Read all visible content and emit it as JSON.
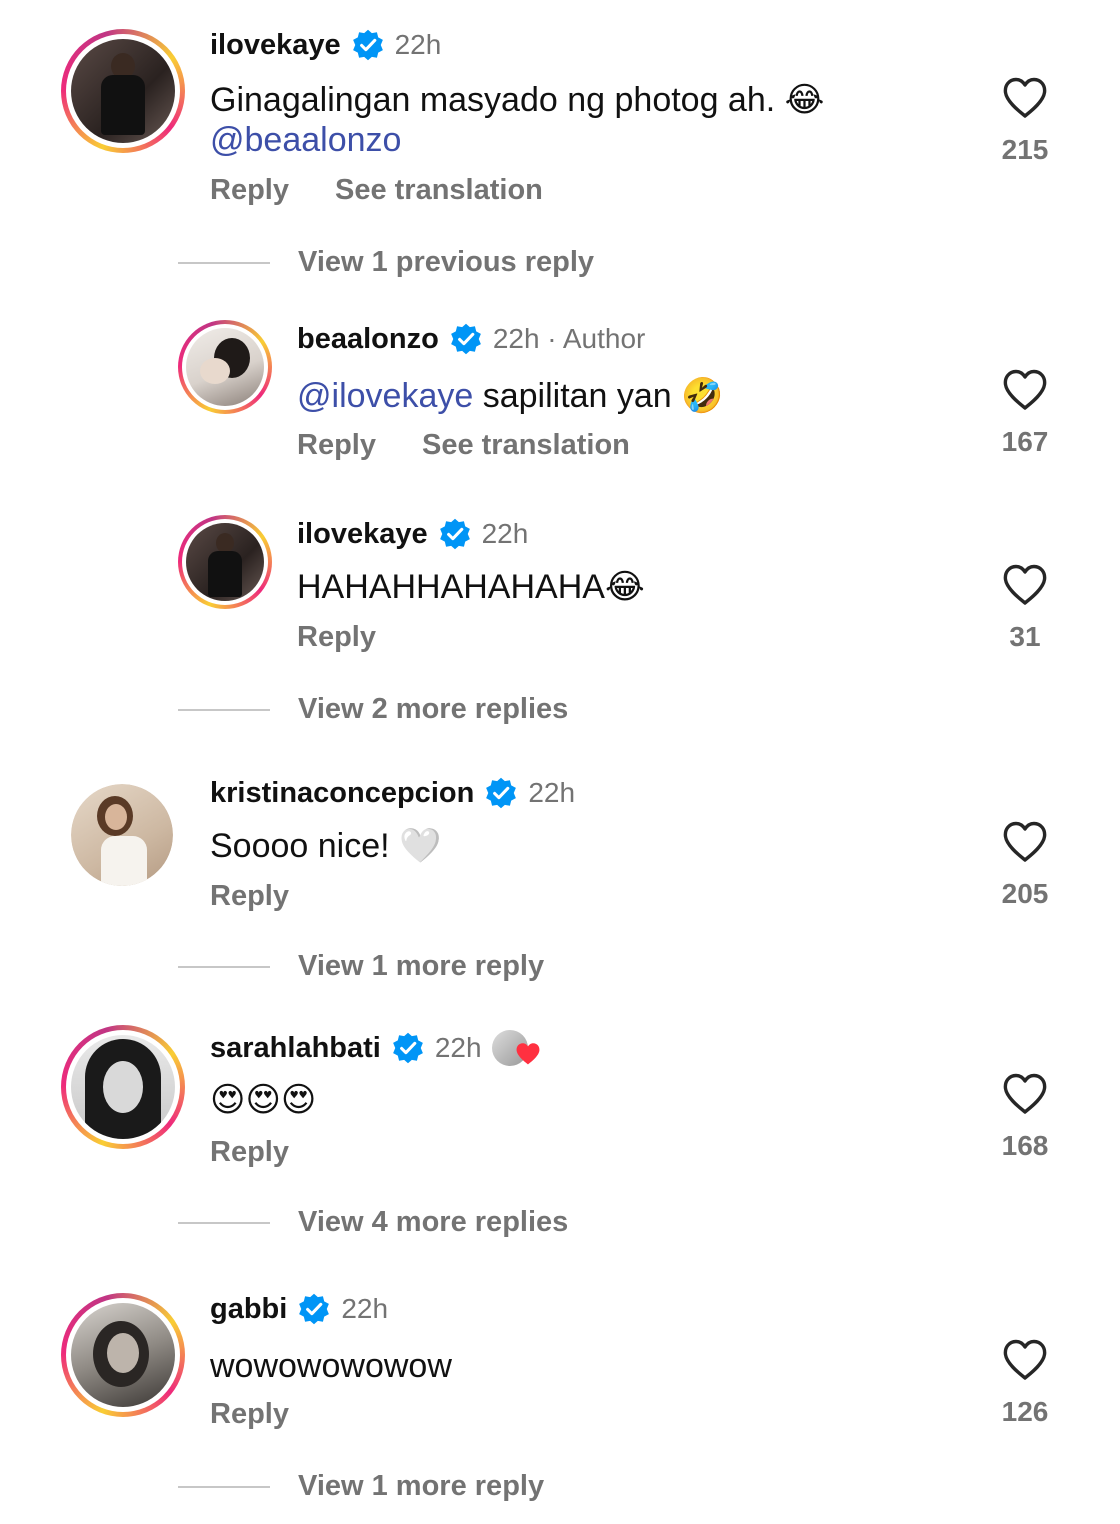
{
  "comments": [
    {
      "user": "ilovekaye",
      "time": "22h",
      "text": "Ginagalingan masyado ng photog ah. 😂",
      "mention": "@beaalonzo",
      "reply": "Reply",
      "translate": "See translation",
      "likes": "215",
      "view_more": "View 1 previous reply"
    },
    {
      "user": "beaalonzo",
      "time": "22h · Author",
      "mention": "@ilovekaye",
      "text": " sapilitan yan 🤣",
      "reply": "Reply",
      "translate": "See translation",
      "likes": "167"
    },
    {
      "user": "ilovekaye",
      "time": "22h",
      "text": "HAHAHHAHAHAHA😂",
      "reply": "Reply",
      "likes": "31",
      "view_more": "View 2 more replies"
    },
    {
      "user": "kristinaconcepcion",
      "time": "22h",
      "text": "Soooo nice! 🤍",
      "reply": "Reply",
      "likes": "205",
      "view_more": "View 1 more reply"
    },
    {
      "user": "sarahlahbati",
      "time": "22h",
      "text": "😍😍😍",
      "reply": "Reply",
      "likes": "168",
      "view_more": "View 4 more replies"
    },
    {
      "user": "gabbi",
      "time": "22h",
      "text": "wowowowowow",
      "reply": "Reply",
      "likes": "126",
      "view_more": "View 1 more reply"
    }
  ],
  "colors": {
    "verified": "#0095f6",
    "secondary_text": "#737373",
    "mention": "#3d4fa8",
    "story_ring": "#ee2a7b"
  },
  "icons": [
    "verified-badge-icon",
    "heart-outline-icon",
    "liked-by-author-icon"
  ]
}
